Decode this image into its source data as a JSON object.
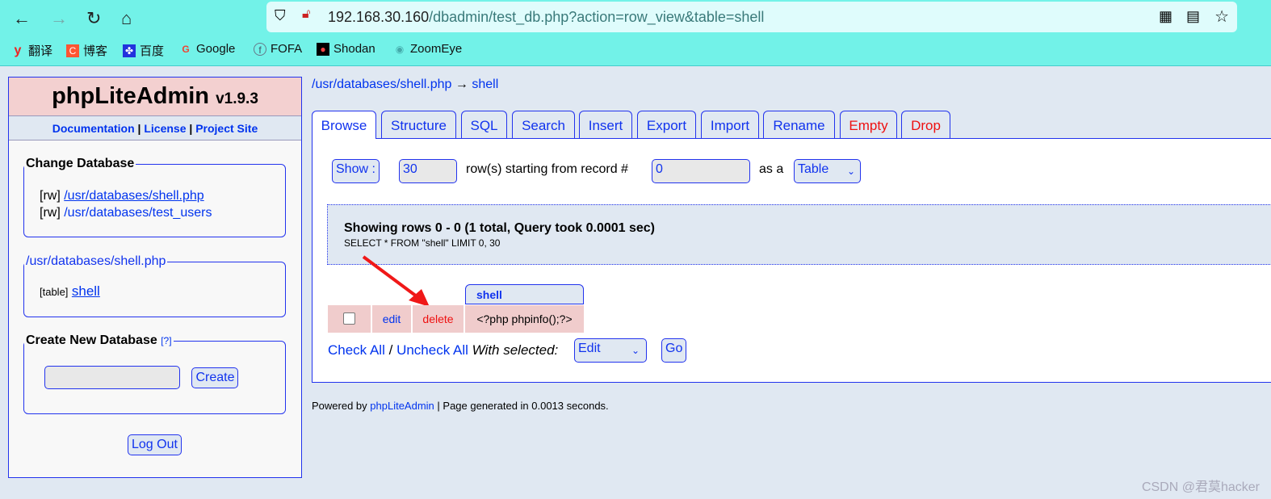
{
  "browser": {
    "url_host": "192.168.30.160",
    "url_path": "/dbadmin/test_db.php?action=row_view&table=shell",
    "bookmarks": [
      "翻译",
      "博客",
      "百度",
      "Google",
      "FOFA",
      "Shodan",
      "ZoomEye"
    ]
  },
  "sidebar": {
    "app_name": "phpLiteAdmin",
    "version": "v1.9.3",
    "links": [
      "Documentation",
      "License",
      "Project Site"
    ],
    "sep": "|",
    "change_db": {
      "legend": "Change Database",
      "items": [
        {
          "mode": "[rw]",
          "path": "/usr/databases/shell.php"
        },
        {
          "mode": "[rw]",
          "path": "/usr/databases/test_users"
        }
      ]
    },
    "current_db": {
      "legend": "/usr/databases/shell.php",
      "type": "[table]",
      "table": "shell"
    },
    "create_db": {
      "legend": "Create New Database",
      "help": "[?]",
      "button": "Create",
      "value": ""
    },
    "logout": "Log Out"
  },
  "breadcrumb": {
    "db": "/usr/databases/shell.php",
    "arrow": "→",
    "table": "shell"
  },
  "tabs": [
    {
      "label": "Browse"
    },
    {
      "label": "Structure"
    },
    {
      "label": "SQL"
    },
    {
      "label": "Search"
    },
    {
      "label": "Insert"
    },
    {
      "label": "Export"
    },
    {
      "label": "Import"
    },
    {
      "label": "Rename"
    },
    {
      "label": "Empty"
    },
    {
      "label": "Drop"
    }
  ],
  "browse": {
    "show_button": "Show :",
    "rows": "30",
    "rows_text": "row(s) starting from record #",
    "start": "0",
    "as_a": "as a",
    "view": "Table",
    "summary": "Showing rows 0 - 0 (1 total, Query took 0.0001 sec)",
    "query": "SELECT * FROM \"shell\" LIMIT 0, 30",
    "column": "shell",
    "row": {
      "edit": "edit",
      "delete": "delete",
      "value": "<?php phpinfo();?>"
    },
    "check_all": "Check All",
    "slash": "/",
    "uncheck_all": "Uncheck All",
    "with_selected": "With selected:",
    "action": "Edit",
    "go": "Go"
  },
  "footer": {
    "prefix": "Powered by",
    "link": "phpLiteAdmin",
    "suffix": "| Page generated in 0.0013 seconds."
  },
  "watermark": "CSDN @君莫hacker"
}
